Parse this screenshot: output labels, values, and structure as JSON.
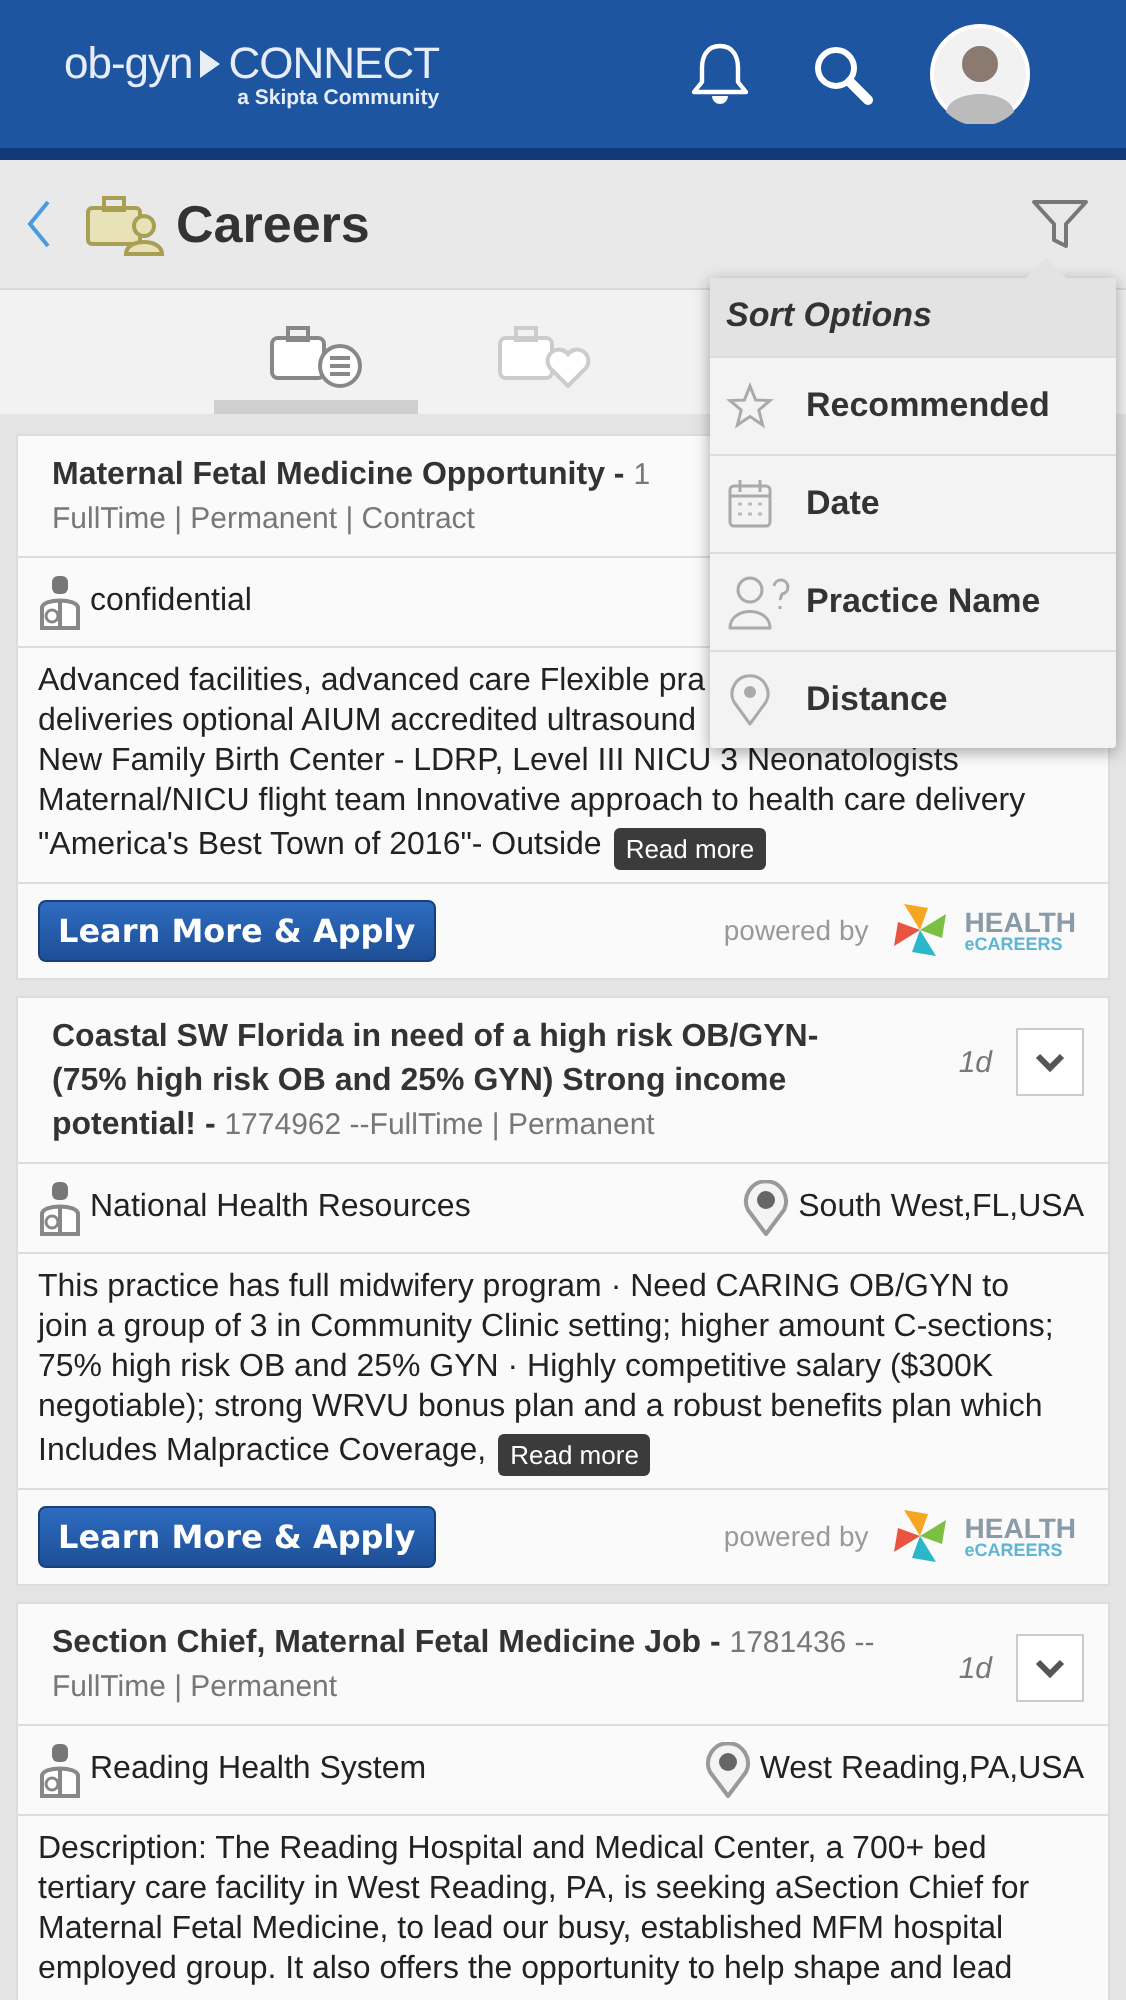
{
  "header": {
    "logo": {
      "left": "ob-gyn",
      "right": "CONNECT",
      "tagline": "a Skipta Community"
    }
  },
  "page": {
    "title": "Careers"
  },
  "tabs": [
    {
      "kind": "list",
      "selected": true
    },
    {
      "kind": "favorites",
      "selected": false
    }
  ],
  "sort_menu": {
    "title": "Sort Options",
    "items": [
      {
        "kind": "star",
        "label": "Recommended"
      },
      {
        "kind": "calendar",
        "label": "Date"
      },
      {
        "kind": "person",
        "label": "Practice Name"
      },
      {
        "kind": "pin",
        "label": "Distance"
      }
    ]
  },
  "jobs": [
    {
      "title": "Maternal Fetal Medicine Opportunity -",
      "ref": "1",
      "types": "FullTime | Permanent | Contract",
      "employer": "confidential",
      "description_lines": [
        "Advanced facilities, advanced care Flexible pra",
        "deliveries optional AIUM accredited ultrasound",
        "New Family Birth Center - LDRP, Level III NICU 3 Neonatologists",
        "Maternal/NICU flight team Innovative approach to health care delivery",
        "\"America's Best Town of 2016\"- Outside"
      ],
      "read_more": "Read more",
      "apply": "Learn More & Apply",
      "powered_by": "powered by",
      "partner": [
        "HEALTH",
        "eCAREERS"
      ]
    },
    {
      "title": "Coastal SW Florida in need of a high risk OB/GYN- (75% high risk OB and 25% GYN) Strong income potential! -",
      "ref": "1774962 --",
      "types": "FullTime | Permanent",
      "age": "1d",
      "employer": "National Health Resources",
      "location": "South West,FL,USA",
      "description_lines": [
        "This practice has full midwifery program · Need CARING OB/GYN to",
        "join a group of 3 in Community Clinic setting; higher amount C-sections;",
        "75% high risk OB and 25% GYN · Highly competitive salary ($300K",
        "negotiable); strong WRVU bonus plan and a robust benefits plan which",
        "Includes Malpractice Coverage,"
      ],
      "read_more": "Read more",
      "apply": "Learn More & Apply",
      "powered_by": "powered by",
      "partner": [
        "HEALTH",
        "eCAREERS"
      ]
    },
    {
      "title": "Section Chief, Maternal Fetal Medicine Job -",
      "ref": "1781436 --",
      "types": "FullTime | Permanent",
      "age": "1d",
      "employer": "Reading Health System",
      "location": "West Reading,PA,USA",
      "description_lines": [
        "Description: The Reading Hospital and Medical Center, a 700+ bed",
        "tertiary care facility in West Reading, PA, is seeking aSection Chief for",
        "Maternal Fetal Medicine, to lead our busy, established MFM hospital",
        "employed group. It also offers the opportunity to help shape and lead"
      ]
    }
  ]
}
